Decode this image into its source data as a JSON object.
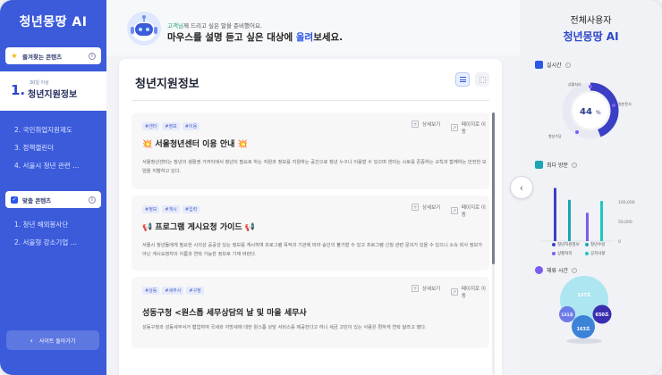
{
  "sidebar": {
    "brand": "청년몽땅 AI",
    "favorites_header": "즐겨찾는 콘텐츠",
    "active": {
      "number": "1.",
      "subtitle": "30일 이상",
      "label": "청년지원정보"
    },
    "items": [
      {
        "label": "2.  국민취업지원제도"
      },
      {
        "label": "3.  정책캘린더"
      },
      {
        "label": "4.  서울시 청년 관련 …"
      }
    ],
    "custom_header": "맞춤 콘텐츠",
    "custom_items": [
      {
        "label": "1.  청년 해외봉사단"
      },
      {
        "label": "2.  서울형 강소기업 …"
      }
    ],
    "back_label": "사이트 돌아가기",
    "back_icon": "chevron-left-icon"
  },
  "header": {
    "greeting_user": "고객님",
    "greeting_rest": "께 드리고 싶은 말을 준비했어요.",
    "prompt_pre": "마우스를 설명 듣고 싶은 대상에 ",
    "prompt_hl": "올려",
    "prompt_post": "보세요."
  },
  "panel": {
    "title": "청년지원정보",
    "detail_label": "상세보기",
    "page_label": "페이지로 이동",
    "cards": [
      {
        "tags": [
          "#센터",
          "#정보",
          "#이용"
        ],
        "title": "💥 서울청년센터 이용 안내 💥",
        "desc": "서울청년센터는 청년의 생활권 가까이에서 청년의 필요로 하는 자원과 정보를 지원하는 공간으로 청년 누구나 이용할 수 있으며 센터는 시로를 존중하는 규칙과 함께하는 안전한 모임을 지향하고 있다."
      },
      {
        "tags": [
          "#정보",
          "#게시",
          "#입력"
        ],
        "title": "📢 프로그램 게시요청 가이드 📢",
        "desc": "서울시 청년들에게 필요한 시의성 공공성 있는 정보를 게시하며 프로그램 목적과 기관에 따라 승인이 불가할 수 있고 프로그램 신청 관련 문의가 있을 수 있으니 소속 회사 정보가 아닌 게시요청자의 이름과 연락 가능한 정보로 기재 바란다."
      },
      {
        "tags": [
          "#상동",
          "#세무사",
          "#구청"
        ],
        "title": "성동구청 <원스톱 세무상담의 날 및 마을 세무사",
        "desc": "성동구청과 성동세무서가 협업하여 국세와 지방세에 대한 원스톱 상담 서비스를 제공한다고 하니 세금 고민이 있는 사람은 편하게 연락 달라고 했다."
      }
    ]
  },
  "right": {
    "title1": "전체사용자",
    "title2": "청년몽땅 AI",
    "realtime_label": "실시간",
    "donut_center": "44",
    "donut_unit": "%",
    "donut_labels": {
      "a": "상황처리",
      "b": "원본문서",
      "c": "향상수당"
    },
    "visits_label": "최다 방문",
    "y_ticks": [
      "100,000",
      "50,000",
      "0"
    ],
    "bar_legend": [
      "청년지원정보",
      "청년수당",
      "상황처리",
      "공지사항"
    ],
    "time_label": "체류 시간",
    "bubbles": [
      "127초",
      "650초",
      "131초",
      "163초"
    ]
  },
  "chart_data": [
    {
      "type": "pie",
      "title": "실시간",
      "center_label": "44%",
      "values": [
        44,
        56
      ]
    },
    {
      "type": "bar",
      "title": "최다 방문",
      "categories": [
        "청년지원정보",
        "청년수당",
        "상황처리",
        "공지사항"
      ],
      "series": [
        {
          "name": "청년지원정보",
          "values": [
            90000
          ]
        },
        {
          "name": "청년수당",
          "values": [
            70000
          ]
        },
        {
          "name": "상황처리",
          "values": [
            48000
          ]
        },
        {
          "name": "공지사항",
          "values": [
            68000
          ]
        }
      ],
      "ylim": [
        0,
        100000
      ],
      "yticks": [
        "100,000",
        "50,000",
        "0"
      ]
    },
    {
      "type": "scatter",
      "title": "체류 시간",
      "values": [
        127,
        650,
        131,
        163
      ],
      "labels": [
        "127초",
        "650초",
        "131초",
        "163초"
      ]
    }
  ]
}
